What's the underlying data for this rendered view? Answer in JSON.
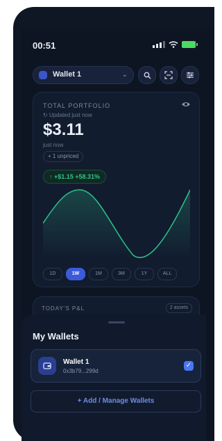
{
  "status": {
    "time": "00:51"
  },
  "wallet_selector": {
    "label": "Wallet 1",
    "chevron": "⌄"
  },
  "toolbar": {
    "search_icon": "search-icon",
    "scan_icon": "scan-icon",
    "filter_icon": "filter-icon"
  },
  "portfolio": {
    "title": "TOTAL PORTFOLIO",
    "updated": "Updated just now",
    "value": "$3.11",
    "timestamp": "just now",
    "unpriced": "+ 1 unpriced",
    "change": "↑ +$1.15 +58.31%",
    "periods": [
      "1D",
      "1W",
      "1M",
      "3M",
      "1Y",
      "ALL"
    ],
    "active_period": "1W"
  },
  "pnl": {
    "title": "TODAY'S P&L",
    "badge": "2 assets"
  },
  "sheet": {
    "title": "My Wallets",
    "wallet": {
      "name": "Wallet 1",
      "address": "0x3b79...299d",
      "selected": true
    },
    "add_button": "+ Add / Manage Wallets"
  },
  "colors": {
    "accent": "#3b5bdb",
    "positive": "#2ec38a",
    "background": "#0d1522"
  }
}
